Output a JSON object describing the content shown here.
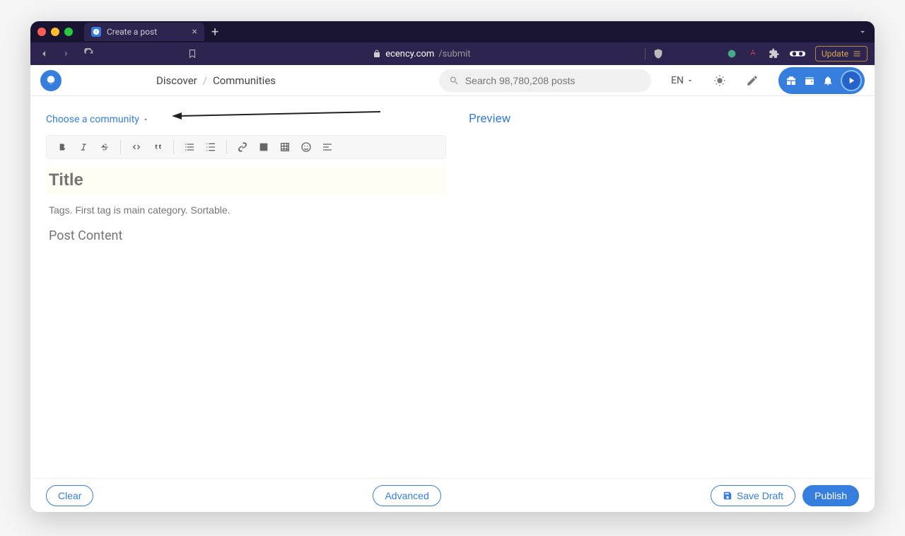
{
  "browser": {
    "tab_title": "Create a post",
    "url_domain": "ecency.com",
    "url_path": "/submit",
    "update_label": "Update"
  },
  "header": {
    "nav": {
      "discover": "Discover",
      "communities": "Communities"
    },
    "search_placeholder": "Search 98,780,208 posts",
    "language": "EN"
  },
  "editor": {
    "community_picker": "Choose a community",
    "title_placeholder": "Title",
    "tags_placeholder": "Tags. First tag is main category. Sortable.",
    "body_placeholder": "Post Content",
    "toolbar": {
      "bold": "bold",
      "italic": "italic",
      "strike": "strikethrough",
      "code": "code",
      "quote": "blockquote",
      "ol": "ordered-list",
      "ul": "unordered-list",
      "link": "link",
      "image": "image",
      "table": "table",
      "emoji": "emoji",
      "align": "align"
    }
  },
  "preview": {
    "label": "Preview"
  },
  "footer": {
    "clear": "Clear",
    "advanced": "Advanced",
    "save_draft": "Save Draft",
    "publish": "Publish"
  },
  "colors": {
    "accent": "#357edd"
  }
}
